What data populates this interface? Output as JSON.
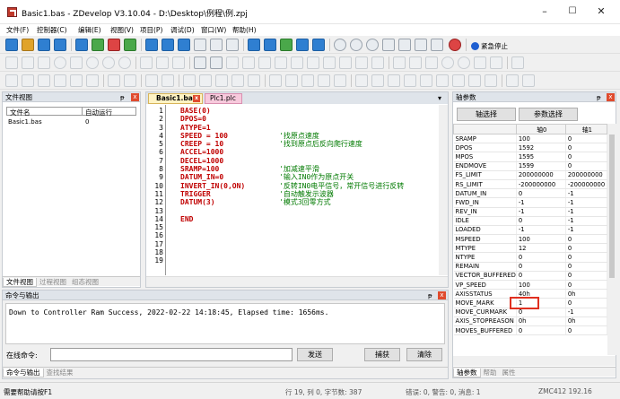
{
  "window": {
    "title": "Basic1.bas - ZDevelop V3.10.04 - D:\\Desktop\\例程\\例.zpj",
    "minimize": "–",
    "maximize": "☐",
    "close": "✕"
  },
  "menu": [
    "文件(F)",
    "控制器(C)",
    "编辑(E)",
    "视图(V)",
    "项目(P)",
    "调试(D)",
    "窗口(W)",
    "帮助(H)"
  ],
  "toolbar": {
    "emergency_stop": "紧急停止"
  },
  "file_view": {
    "title": "文件视图",
    "pin": "ᵽ",
    "close": "x",
    "columns": [
      "文件名",
      "自动运行"
    ],
    "rows": [
      {
        "name": "Basic1.bas",
        "auto": "0"
      }
    ],
    "tabs": [
      "文件视图",
      "过程视图",
      "组态视图"
    ]
  },
  "editor": {
    "tabs": [
      {
        "label": "Basic1.bas",
        "close": "x"
      },
      {
        "label": "Plc1.plc"
      }
    ],
    "tab_menu": "▾",
    "line_numbers": [
      "1",
      "2",
      "3",
      "4",
      "5",
      "6",
      "7",
      "8",
      "9",
      "10",
      "11",
      "12",
      "13",
      "14",
      "15",
      "16",
      "17",
      "18",
      "19"
    ],
    "lines": [
      {
        "code": "BASE(0)",
        "comment": ""
      },
      {
        "code": "DPOS=0",
        "comment": ""
      },
      {
        "code": "ATYPE=1",
        "comment": ""
      },
      {
        "code": "SPEED = 100",
        "comment": "'找原点速度"
      },
      {
        "code": "CREEP = 10",
        "comment": "'找到原点后反向爬行速度"
      },
      {
        "code": "ACCEL=1000",
        "comment": ""
      },
      {
        "code": "DECEL=1000",
        "comment": ""
      },
      {
        "code": "SRAMP=100",
        "comment": "'加减速平滑"
      },
      {
        "code": "DATUM_IN=0",
        "comment": "'输入IN0作为原点开关"
      },
      {
        "code": "INVERT_IN(0,ON)",
        "comment": "'反转IN0电平信号，常开信号进行反转"
      },
      {
        "code": "TRIGGER",
        "comment": "'自动触发示波器"
      },
      {
        "code": "DATUM(3)",
        "comment": "'模式3回零方式"
      },
      {
        "code": "",
        "comment": ""
      },
      {
        "code": "END",
        "comment": ""
      },
      {
        "code": "",
        "comment": ""
      },
      {
        "code": "",
        "comment": ""
      },
      {
        "code": "",
        "comment": ""
      },
      {
        "code": "",
        "comment": ""
      },
      {
        "code": "",
        "comment": ""
      }
    ]
  },
  "axis_params": {
    "title": "轴参数",
    "pin": "ᵽ",
    "close": "x",
    "select_axis_btn": "轴选择",
    "select_param_btn": "参数选择",
    "headers": [
      "",
      "轴0",
      "轴1"
    ],
    "rows": [
      [
        "SRAMP",
        "100",
        "0"
      ],
      [
        "DPOS",
        "1592",
        "0"
      ],
      [
        "MPOS",
        "1595",
        "0"
      ],
      [
        "ENDMOVE",
        "1599",
        "0"
      ],
      [
        "FS_LIMIT",
        "200000000",
        "200000000"
      ],
      [
        "RS_LIMIT",
        "-200000000",
        "-200000000"
      ],
      [
        "DATUM_IN",
        "0",
        "-1"
      ],
      [
        "FWD_IN",
        "-1",
        "-1"
      ],
      [
        "REV_IN",
        "-1",
        "-1"
      ],
      [
        "IDLE",
        "0",
        "-1"
      ],
      [
        "LOADED",
        "-1",
        "-1"
      ],
      [
        "MSPEED",
        "100",
        "0"
      ],
      [
        "MTYPE",
        "12",
        "0"
      ],
      [
        "NTYPE",
        "0",
        "0"
      ],
      [
        "REMAIN",
        "0",
        "0"
      ],
      [
        "VECTOR_BUFFERED",
        "0",
        "0"
      ],
      [
        "VP_SPEED",
        "100",
        "0"
      ],
      [
        "AXISSTATUS",
        "40h",
        "0h"
      ],
      [
        "MOVE_MARK",
        "1",
        "0"
      ],
      [
        "MOVE_CURMARK",
        "0",
        "-1"
      ],
      [
        "AXIS_STOPREASON",
        "0h",
        "0h"
      ],
      [
        "MOVES_BUFFERED",
        "0",
        "0"
      ]
    ],
    "tabs": [
      "轴参数",
      "帮助",
      "属性"
    ]
  },
  "output": {
    "title": "命令与输出",
    "pin": "ᵽ",
    "close": "x",
    "text": "Down to Controller Ram Success, 2022-02-22 14:18:45, Elapsed time: 1656ms.",
    "command_label": "在线命令:",
    "command_value": "",
    "send_btn": "发送",
    "capture_btn": "捕获",
    "clear_btn": "清除",
    "tabs": [
      "命令与输出",
      "查找结果"
    ]
  },
  "status": {
    "help": "需要帮助请按F1",
    "position": "行 19, 列 0, 字节数: 387",
    "errors": "错误: 0, 警告: 0, 消息: 1",
    "controller": "ZMC412 192.16"
  },
  "colors": {
    "highlight_box": "#e03020",
    "keyword": "#c00000",
    "comment": "#007a00"
  }
}
